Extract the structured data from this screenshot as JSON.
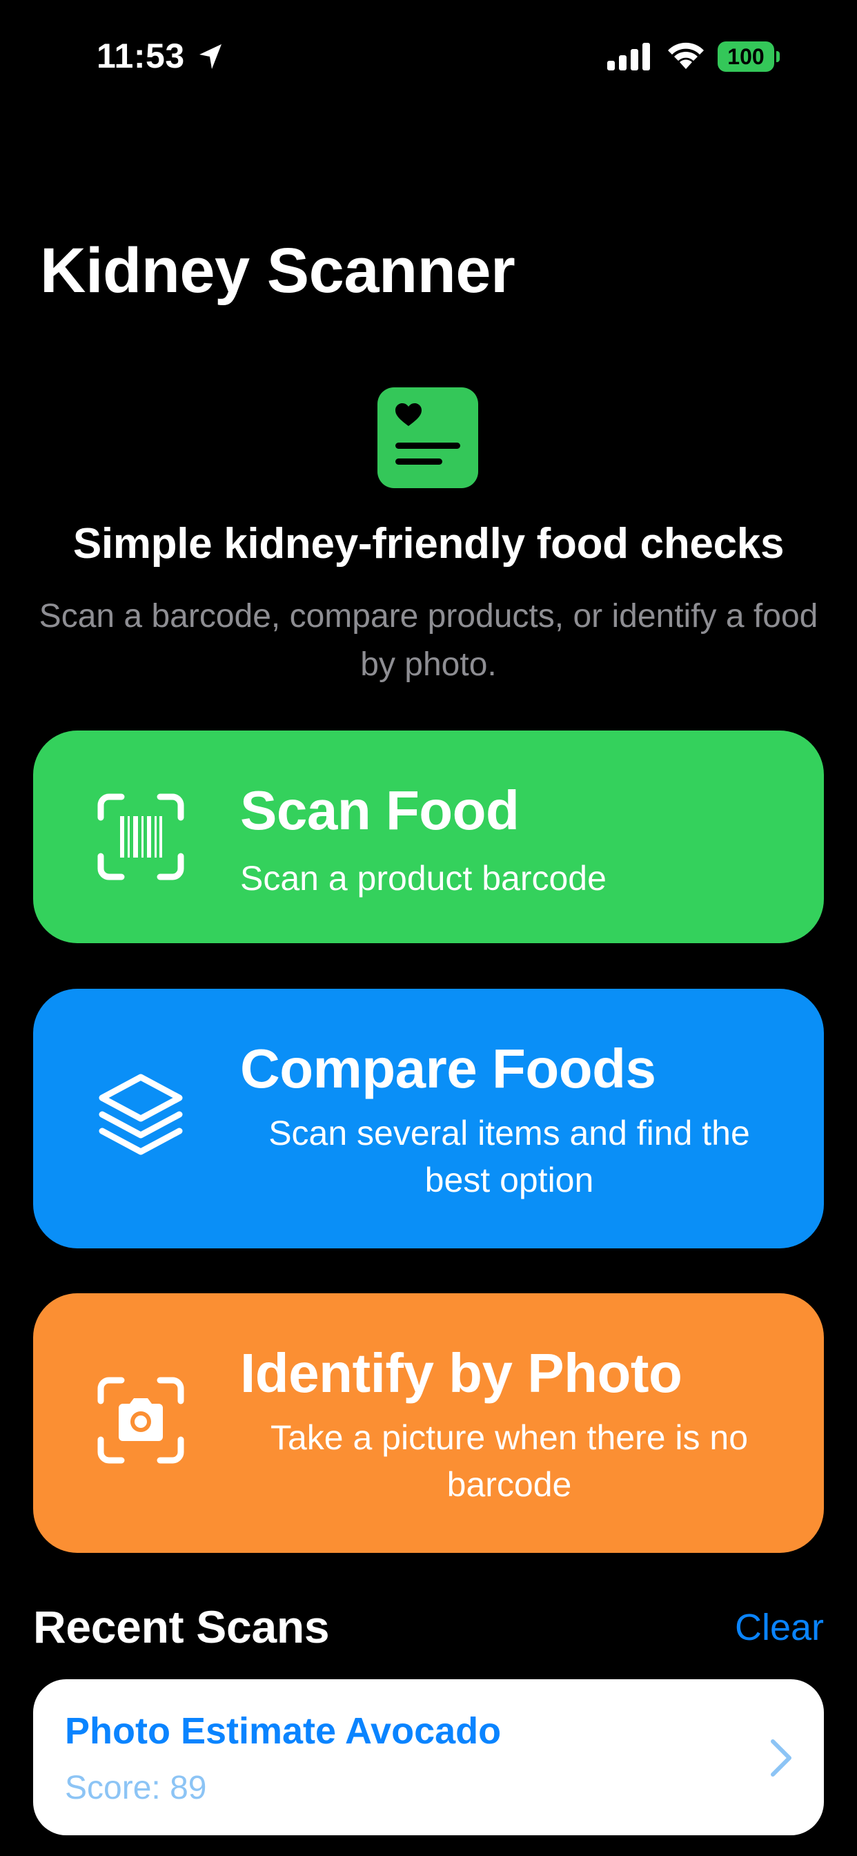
{
  "status_bar": {
    "time": "11:53",
    "battery": "100",
    "icons": [
      "location-arrow-icon",
      "cellular-signal-icon",
      "wifi-icon",
      "battery-icon"
    ]
  },
  "header": {
    "title": "Kidney Scanner"
  },
  "hero": {
    "icon": "heart-document-icon",
    "headline": "Simple kidney-friendly food checks",
    "subhead": "Scan a barcode, compare products, or identify a food by photo."
  },
  "actions": [
    {
      "title": "Scan Food",
      "subtitle": "Scan a product barcode",
      "icon": "barcode-scan-icon",
      "color": "#34d15c"
    },
    {
      "title": "Compare Foods",
      "subtitle": "Scan several items and find the best option",
      "icon": "stack-layers-icon",
      "color": "#0a8ff7"
    },
    {
      "title": "Identify by Photo",
      "subtitle": "Take a picture when there is no barcode",
      "icon": "camera-scan-icon",
      "color": "#fb8f33"
    }
  ],
  "recent": {
    "title": "Recent Scans",
    "clear_label": "Clear",
    "items": [
      {
        "name": "Photo Estimate Avocado",
        "score": "Score: 89",
        "icon": "chevron-right-icon"
      }
    ]
  },
  "colors": {
    "background": "#000000",
    "accent_blue": "#0a84ff",
    "accent_green": "#34c759",
    "secondary_text": "#8e8e93"
  }
}
